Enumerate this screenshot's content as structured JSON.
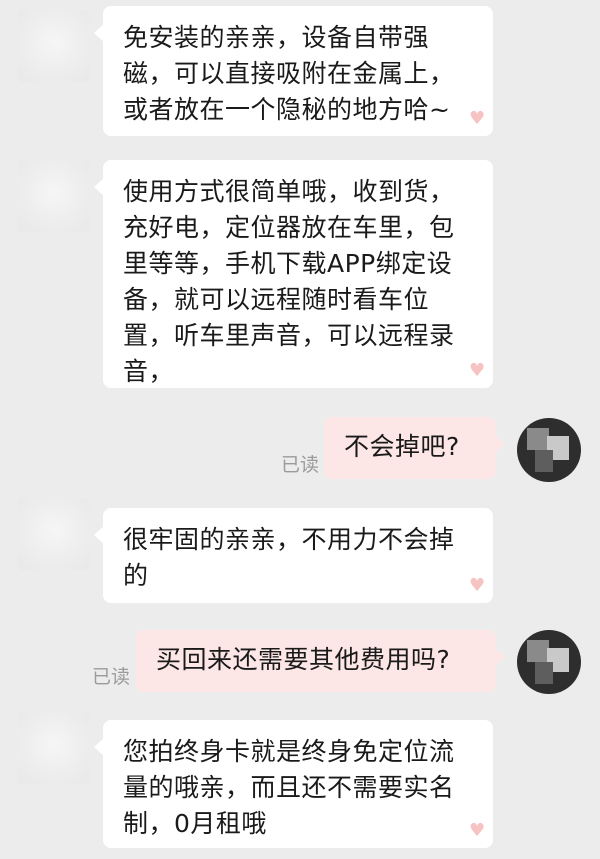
{
  "messages": [
    {
      "side": "left",
      "text": "免安装的亲亲，设备自带强\n磁，可以直接吸附在金属上，\n或者放在一个隐秘的地方哈~"
    },
    {
      "side": "left",
      "text": "使用方式很简单哦，收到货，\n充好电，定位器放在车里，包\n里等等，手机下载APP绑定设\n备，就可以远程随时看车位\n置，听车里声音，可以远程录\n音，"
    },
    {
      "side": "right",
      "text": "不会掉吧?",
      "status": "已读"
    },
    {
      "side": "left",
      "text": "很牢固的亲亲，不用力不会掉\n的"
    },
    {
      "side": "right",
      "text": "买回来还需要其他费用吗?",
      "status": "已读"
    },
    {
      "side": "left",
      "text": "您拍终身卡就是终身免定位流\n量的哦亲，而且还不需要实名\n制，0月租哦"
    }
  ],
  "colors": {
    "background": "#ececec",
    "incoming_bubble": "#ffffff",
    "outgoing_bubble": "#fce6e6",
    "read_status": "#9b9b9b",
    "sticker_heart": "#f5b8b8"
  },
  "icons": {
    "incoming_avatar": "blurred-avatar",
    "outgoing_avatar": "pixelated-avatar",
    "bubble_sticker": "heart-icon"
  }
}
